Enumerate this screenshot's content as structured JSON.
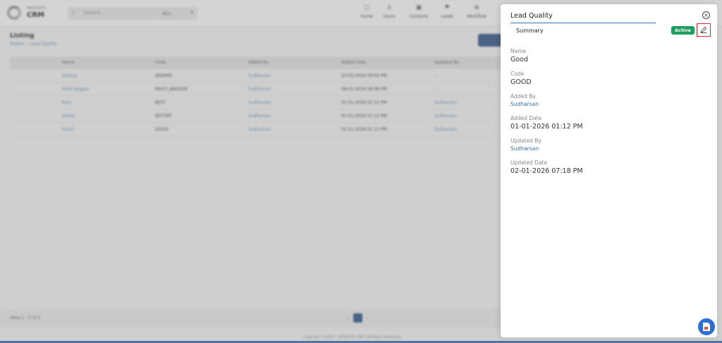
{
  "header": {
    "brand_small": "INSIGHTS",
    "brand_big": "CRM",
    "search_placeholder": "Search...",
    "search_scope": "ALL",
    "nav": [
      {
        "label": "Home",
        "icon": "home-icon"
      },
      {
        "label": "Users",
        "icon": "user-icon"
      },
      {
        "label": "Contacts",
        "icon": "contacts-icon"
      },
      {
        "label": "Leads",
        "icon": "leads-icon"
      },
      {
        "label": "Workflow",
        "icon": "workflow-icon"
      }
    ]
  },
  "listing": {
    "title": "Listing",
    "breadcrumb": [
      "Master",
      "Lead Quality"
    ],
    "columns": [
      "Name",
      "Code",
      "Added By",
      "Added Date",
      "Updated By"
    ],
    "rows": [
      {
        "name": "Adding",
        "code": "ADDING",
        "added_by": "Sudharsan",
        "added_date": "20-05-2026 09:04 PM",
        "updated_by": "-"
      },
      {
        "name": "Multi Bagger",
        "code": "MULTI_BAGGER",
        "added_by": "Sudharsan",
        "added_date": "08-01-2026 06:08 PM",
        "updated_by": "-"
      },
      {
        "name": "Best",
        "code": "BEST",
        "added_by": "Sudharsan",
        "added_date": "01-01-2026 01:12 PM",
        "updated_by": "Sudharsan"
      },
      {
        "name": "Better",
        "code": "BETTER",
        "added_by": "Sudharsan",
        "added_date": "01-01-2026 01:12 PM",
        "updated_by": "Sudharsan"
      },
      {
        "name": "Good",
        "code": "GOOD",
        "added_by": "Sudharsan",
        "added_date": "01-01-2026 01:12 PM",
        "updated_by": "Sudharsan"
      }
    ],
    "showing": "View 1 - 5 of 5",
    "page": "1",
    "copyright": "Copyright ©2026 • INSIGHTS CRM. All Rights Reserved."
  },
  "drawer": {
    "title": "Lead Quality",
    "tab": "Summary",
    "status": "Active",
    "fields": {
      "name_label": "Name",
      "name_value": "Good",
      "code_label": "Code",
      "code_value": "GOOD",
      "added_by_label": "Added By",
      "added_by_value": "Sudharsan",
      "added_date_label": "Added Date",
      "added_date_value": "01-01-2026 01:12 PM",
      "updated_by_label": "Updated By",
      "updated_by_value": "Sudharsan",
      "updated_date_label": "Updated Date",
      "updated_date_value": "02-01-2026 07:18 PM"
    }
  },
  "colors": {
    "accent": "#3a6fb8",
    "status_active": "#19a05f",
    "highlight": "#e02424"
  }
}
